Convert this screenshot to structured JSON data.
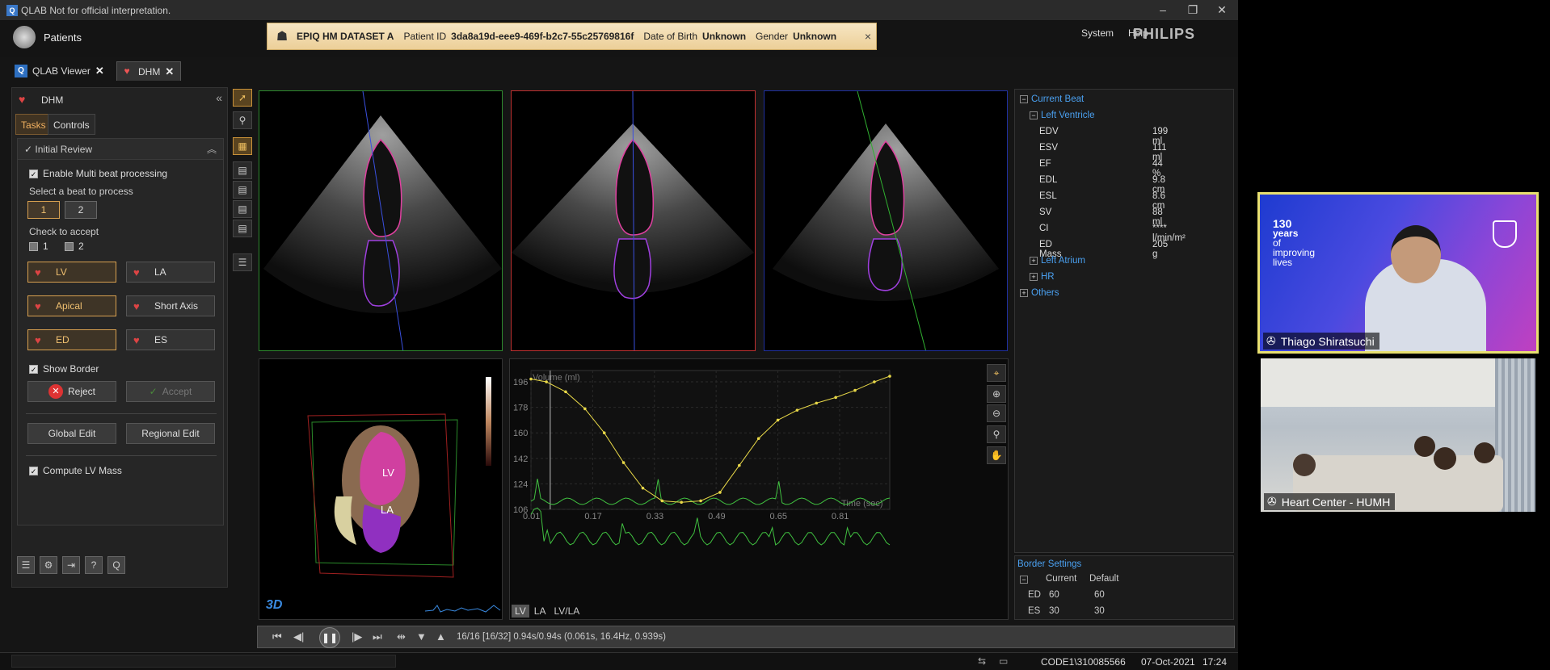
{
  "titlebar": {
    "title": "QLAB Not for official interpretation.",
    "minimize": "–",
    "maximize": "❐",
    "close": "✕"
  },
  "header": {
    "patients_label": "Patients",
    "banner": {
      "dataset": "EPIQ HM DATASET A",
      "patient_id_label": "Patient ID",
      "patient_id": "3da8a19d-eee9-469f-b2c7-55c25769816f",
      "dob_label": "Date of Birth",
      "dob": "Unknown",
      "gender_label": "Gender",
      "gender": "Unknown",
      "close": "×"
    },
    "system": "System",
    "help": "Help",
    "brand": "PHILIPS"
  },
  "tabs": [
    {
      "label": "QLAB Viewer",
      "icon": "Q"
    },
    {
      "label": "DHM",
      "icon": "heart"
    }
  ],
  "left_panel": {
    "title": "DHM",
    "collapse": "«",
    "subtabs": [
      "Tasks",
      "Controls"
    ],
    "section_title": "Initial Review",
    "enable_multibeat": "Enable Multi beat processing",
    "select_beat_label": "Select a beat to process",
    "beats": [
      "1",
      "2"
    ],
    "check_accept_label": "Check to accept",
    "accept_checks": [
      "1",
      "2"
    ],
    "chamber_buttons": [
      "LV",
      "LA"
    ],
    "view_buttons": [
      "Apical",
      "Short Axis"
    ],
    "phase_buttons": [
      "ED",
      "ES"
    ],
    "show_border": "Show Border",
    "reject": "Reject",
    "accept": "Accept",
    "global_edit": "Global Edit",
    "regional_edit": "Regional Edit",
    "compute_lv_mass": "Compute LV Mass"
  },
  "views": {
    "badge_3d": "3D",
    "lv_label": "LV",
    "la_label": "LA"
  },
  "volume_chart": {
    "tabs": [
      "LV",
      "LA",
      "LV/LA"
    ]
  },
  "chart_data": {
    "type": "line",
    "title": "",
    "ylabel": "Volume (ml)",
    "xlabel": "Time (sec)",
    "x_ticks": [
      "0.01",
      "0.17",
      "0.33",
      "0.49",
      "0.65",
      "0.81"
    ],
    "y_ticks": [
      "106",
      "124",
      "142",
      "160",
      "178",
      "196"
    ],
    "xlim": [
      0.01,
      0.94
    ],
    "ylim": [
      106,
      204
    ],
    "series": [
      {
        "x": [
          0.01,
          0.05,
          0.1,
          0.15,
          0.2,
          0.25,
          0.3,
          0.35,
          0.4,
          0.45,
          0.5,
          0.55,
          0.6,
          0.65,
          0.7,
          0.75,
          0.8,
          0.85,
          0.9,
          0.94
        ],
        "values": [
          198,
          196,
          189,
          177,
          160,
          139,
          121,
          112,
          111,
          112,
          118,
          137,
          156,
          169,
          176,
          181,
          185,
          190,
          196,
          200
        ]
      }
    ]
  },
  "measurements": {
    "current_beat": "Current Beat",
    "left_ventricle": "Left Ventricle",
    "rows": [
      {
        "name": "EDV",
        "value": "199 ml"
      },
      {
        "name": "ESV",
        "value": "111 ml"
      },
      {
        "name": "EF",
        "value": "44 %"
      },
      {
        "name": "EDL",
        "value": "9.8 cm"
      },
      {
        "name": "ESL",
        "value": "8.6 cm"
      },
      {
        "name": "SV",
        "value": "88 ml"
      },
      {
        "name": "CI",
        "value": "**** l/min/m²"
      },
      {
        "name": "ED Mass",
        "value": "205 g"
      }
    ],
    "left_atrium": "Left Atrium",
    "hr": "HR",
    "others": "Others"
  },
  "border_settings": {
    "title": "Border Settings",
    "col_current": "Current",
    "col_default": "Default",
    "rows": [
      {
        "name": "ED",
        "current": "60",
        "default": "60"
      },
      {
        "name": "ES",
        "current": "30",
        "default": "30"
      }
    ]
  },
  "playbar": {
    "frame_info": "16/16  [16/32] 0.94s/0.94s (0.061s, 16.4Hz, 0.939s)"
  },
  "statusbar": {
    "user": "CODE1\\310085566",
    "date": "07-Oct-2021",
    "time": "17:24"
  },
  "video": {
    "participant1": "Thiago Shiratsuchi",
    "participant2": "Heart Center - HUMH",
    "slide_text_1": "130",
    "slide_text_2": "years",
    "slide_text_3": "of",
    "slide_text_4": "improving",
    "slide_text_5": "lives"
  },
  "colors": {
    "accent": "#f0b060",
    "link": "#4aa0f0",
    "volume_curve": "#e8d848",
    "ecg": "#40c040"
  }
}
